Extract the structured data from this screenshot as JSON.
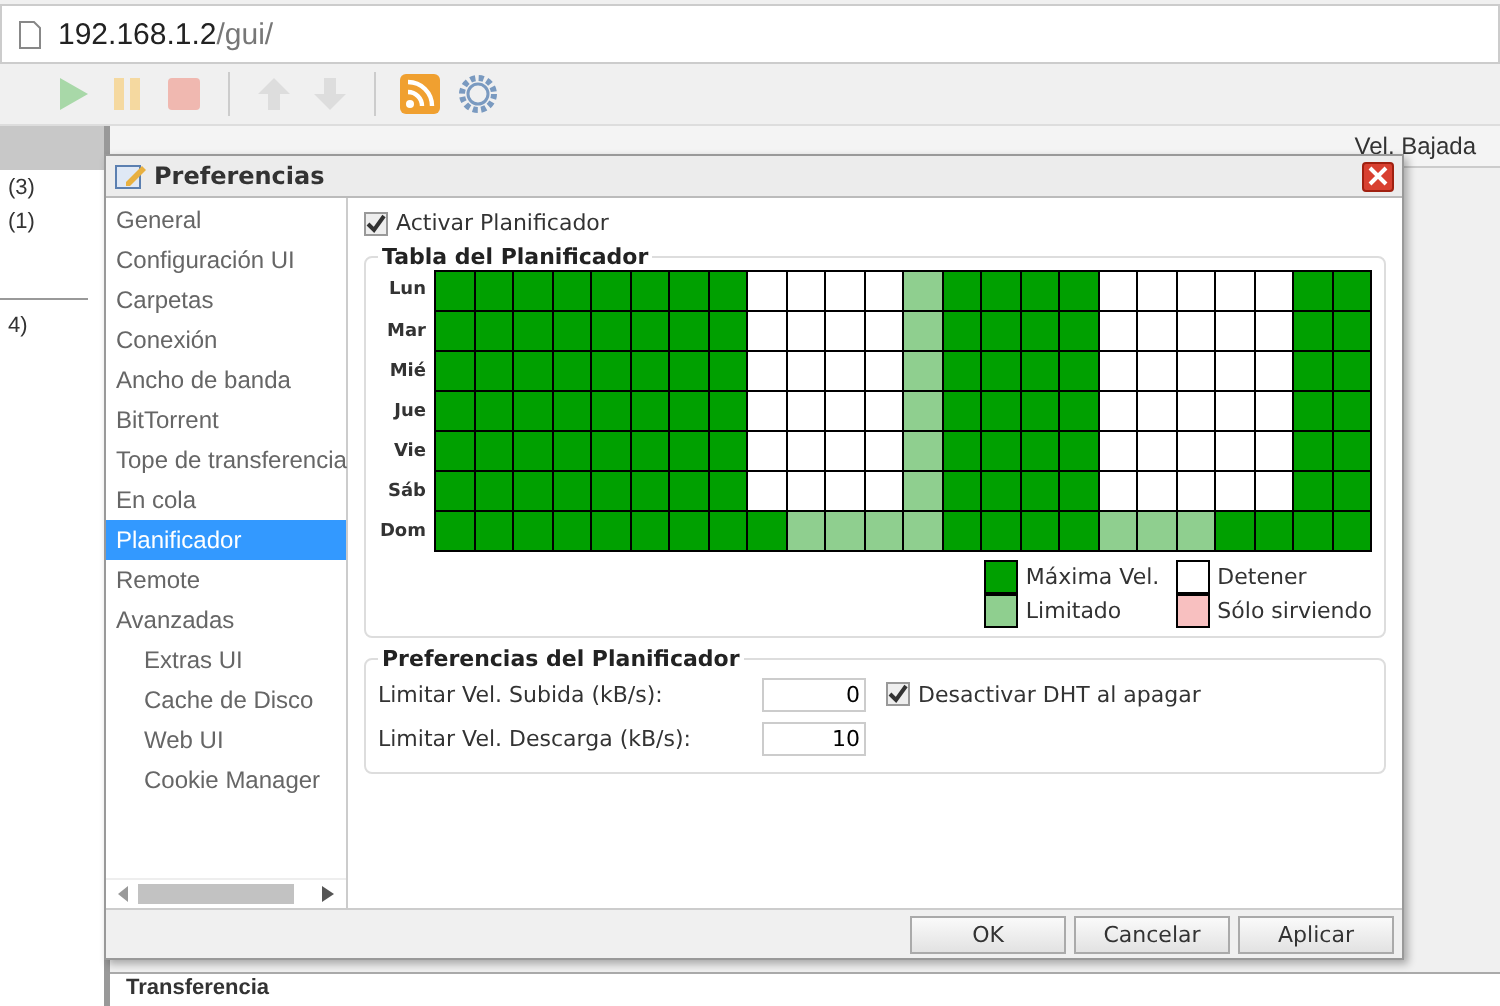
{
  "browser": {
    "url_host": "192.168.1.2",
    "url_path": "/gui/"
  },
  "background": {
    "column_header": "Vel. Bajada",
    "side_counts": [
      "(3)",
      "(1)",
      "4)"
    ],
    "bottom_label": "Transferencia"
  },
  "dialog": {
    "title": "Preferencias",
    "sidebar": {
      "items": [
        {
          "label": "General",
          "selected": false
        },
        {
          "label": "Configuración UI",
          "selected": false
        },
        {
          "label": "Carpetas",
          "selected": false
        },
        {
          "label": "Conexión",
          "selected": false
        },
        {
          "label": "Ancho de banda",
          "selected": false
        },
        {
          "label": "BitTorrent",
          "selected": false
        },
        {
          "label": "Tope de transferencia",
          "selected": false
        },
        {
          "label": "En cola",
          "selected": false
        },
        {
          "label": "Planificador",
          "selected": true
        },
        {
          "label": "Remote",
          "selected": false
        },
        {
          "label": "Avanzadas",
          "selected": false,
          "children": [
            {
              "label": "Extras UI",
              "selected": false
            },
            {
              "label": "Cache de Disco",
              "selected": false
            },
            {
              "label": "Web UI",
              "selected": false
            },
            {
              "label": "Cookie Manager",
              "selected": false
            }
          ]
        }
      ]
    },
    "enable_scheduler": {
      "label": "Activar Planificador",
      "checked": true
    },
    "schedule_table": {
      "title": "Tabla del Planificador",
      "rows": [
        {
          "day": "Lun",
          "cells": [
            {
              "kind": "F"
            },
            {
              "kind": "F"
            },
            {
              "kind": "F"
            },
            {
              "kind": "F"
            },
            {
              "kind": "F"
            },
            {
              "kind": "F"
            },
            {
              "kind": "F"
            },
            {
              "kind": "F"
            },
            {
              "kind": "S"
            },
            {
              "kind": "S"
            },
            {
              "kind": "S"
            },
            {
              "kind": "S"
            },
            {
              "kind": "L"
            },
            {
              "kind": "F"
            },
            {
              "kind": "F"
            },
            {
              "kind": "F"
            },
            {
              "kind": "F"
            },
            {
              "kind": "S"
            },
            {
              "kind": "S"
            },
            {
              "kind": "S"
            },
            {
              "kind": "S"
            },
            {
              "kind": "S"
            },
            {
              "kind": "F"
            },
            {
              "kind": "F"
            }
          ]
        },
        {
          "day": "Mar",
          "cells": [
            {
              "kind": "F"
            },
            {
              "kind": "F"
            },
            {
              "kind": "F"
            },
            {
              "kind": "F"
            },
            {
              "kind": "F"
            },
            {
              "kind": "F"
            },
            {
              "kind": "F"
            },
            {
              "kind": "F"
            },
            {
              "kind": "S"
            },
            {
              "kind": "S"
            },
            {
              "kind": "S"
            },
            {
              "kind": "S"
            },
            {
              "kind": "L"
            },
            {
              "kind": "F"
            },
            {
              "kind": "F"
            },
            {
              "kind": "F"
            },
            {
              "kind": "F"
            },
            {
              "kind": "S"
            },
            {
              "kind": "S"
            },
            {
              "kind": "S"
            },
            {
              "kind": "S"
            },
            {
              "kind": "S"
            },
            {
              "kind": "F"
            },
            {
              "kind": "F"
            }
          ]
        },
        {
          "day": "Mié",
          "cells": [
            {
              "kind": "F"
            },
            {
              "kind": "F"
            },
            {
              "kind": "F"
            },
            {
              "kind": "F"
            },
            {
              "kind": "F"
            },
            {
              "kind": "F"
            },
            {
              "kind": "F"
            },
            {
              "kind": "F"
            },
            {
              "kind": "S"
            },
            {
              "kind": "S"
            },
            {
              "kind": "S"
            },
            {
              "kind": "S"
            },
            {
              "kind": "L"
            },
            {
              "kind": "F"
            },
            {
              "kind": "F"
            },
            {
              "kind": "F"
            },
            {
              "kind": "F"
            },
            {
              "kind": "S"
            },
            {
              "kind": "S"
            },
            {
              "kind": "S"
            },
            {
              "kind": "S"
            },
            {
              "kind": "S"
            },
            {
              "kind": "F"
            },
            {
              "kind": "F"
            }
          ]
        },
        {
          "day": "Jue",
          "cells": [
            {
              "kind": "F"
            },
            {
              "kind": "F"
            },
            {
              "kind": "F"
            },
            {
              "kind": "F"
            },
            {
              "kind": "F"
            },
            {
              "kind": "F"
            },
            {
              "kind": "F"
            },
            {
              "kind": "F"
            },
            {
              "kind": "S"
            },
            {
              "kind": "S"
            },
            {
              "kind": "S"
            },
            {
              "kind": "S"
            },
            {
              "kind": "L"
            },
            {
              "kind": "F"
            },
            {
              "kind": "F"
            },
            {
              "kind": "F"
            },
            {
              "kind": "F"
            },
            {
              "kind": "S"
            },
            {
              "kind": "S"
            },
            {
              "kind": "S"
            },
            {
              "kind": "S"
            },
            {
              "kind": "S"
            },
            {
              "kind": "F"
            },
            {
              "kind": "F"
            }
          ]
        },
        {
          "day": "Vie",
          "cells": [
            {
              "kind": "F"
            },
            {
              "kind": "F"
            },
            {
              "kind": "F"
            },
            {
              "kind": "F"
            },
            {
              "kind": "F"
            },
            {
              "kind": "F"
            },
            {
              "kind": "F"
            },
            {
              "kind": "F"
            },
            {
              "kind": "S"
            },
            {
              "kind": "S"
            },
            {
              "kind": "S"
            },
            {
              "kind": "S"
            },
            {
              "kind": "L"
            },
            {
              "kind": "F"
            },
            {
              "kind": "F"
            },
            {
              "kind": "F"
            },
            {
              "kind": "F"
            },
            {
              "kind": "S"
            },
            {
              "kind": "S"
            },
            {
              "kind": "S"
            },
            {
              "kind": "S"
            },
            {
              "kind": "S"
            },
            {
              "kind": "F"
            },
            {
              "kind": "F"
            }
          ]
        },
        {
          "day": "Sáb",
          "cells": [
            {
              "kind": "F"
            },
            {
              "kind": "F"
            },
            {
              "kind": "F"
            },
            {
              "kind": "F"
            },
            {
              "kind": "F"
            },
            {
              "kind": "F"
            },
            {
              "kind": "F"
            },
            {
              "kind": "F"
            },
            {
              "kind": "S"
            },
            {
              "kind": "S"
            },
            {
              "kind": "S"
            },
            {
              "kind": "S"
            },
            {
              "kind": "L"
            },
            {
              "kind": "F"
            },
            {
              "kind": "F"
            },
            {
              "kind": "F"
            },
            {
              "kind": "F"
            },
            {
              "kind": "S"
            },
            {
              "kind": "S"
            },
            {
              "kind": "S"
            },
            {
              "kind": "S"
            },
            {
              "kind": "S"
            },
            {
              "kind": "F"
            },
            {
              "kind": "F"
            }
          ]
        },
        {
          "day": "Dom",
          "cells": [
            {
              "kind": "F"
            },
            {
              "kind": "F"
            },
            {
              "kind": "F"
            },
            {
              "kind": "F"
            },
            {
              "kind": "F"
            },
            {
              "kind": "F"
            },
            {
              "kind": "F"
            },
            {
              "kind": "F"
            },
            {
              "kind": "F"
            },
            {
              "kind": "L"
            },
            {
              "kind": "L"
            },
            {
              "kind": "L"
            },
            {
              "kind": "L"
            },
            {
              "kind": "F"
            },
            {
              "kind": "F"
            },
            {
              "kind": "F"
            },
            {
              "kind": "F"
            },
            {
              "kind": "L"
            },
            {
              "kind": "L"
            },
            {
              "kind": "L"
            },
            {
              "kind": "F"
            },
            {
              "kind": "F"
            },
            {
              "kind": "F"
            },
            {
              "kind": "F"
            }
          ]
        }
      ],
      "legend": [
        {
          "kind": "F",
          "label": "Máxima Vel."
        },
        {
          "kind": "S",
          "label": "Detener"
        },
        {
          "kind": "L",
          "label": "Limitado"
        },
        {
          "kind": "P",
          "label": "Sólo sirviendo"
        }
      ]
    },
    "scheduler_prefs": {
      "title": "Preferencias del Planificador",
      "upload_label": "Limitar Vel. Subida (kB/s):",
      "upload_value": "0",
      "download_label": "Limitar Vel. Descarga (kB/s):",
      "download_value": "10",
      "dht": {
        "label": "Desactivar DHT al apagar",
        "checked": true
      }
    },
    "buttons": [
      "OK",
      "Cancelar",
      "Aplicar"
    ]
  }
}
